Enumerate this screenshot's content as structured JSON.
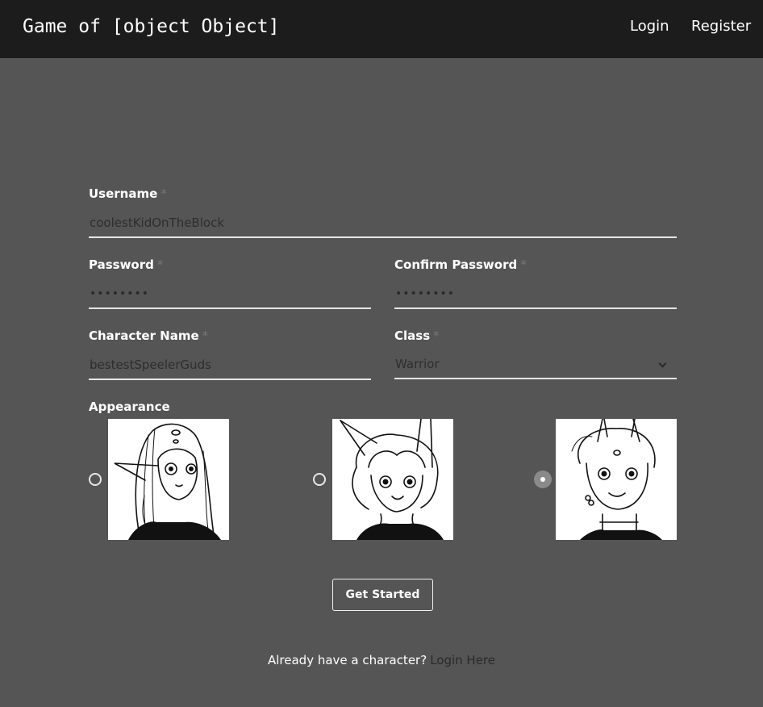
{
  "navbar": {
    "brand": "Game of [object Object]",
    "login": "Login",
    "register": "Register"
  },
  "form": {
    "username": {
      "label": "Username",
      "required_mark": "*",
      "value": "coolestKidOnTheBlock"
    },
    "password": {
      "label": "Password",
      "required_mark": "*",
      "value": "••••••••"
    },
    "confirm_password": {
      "label": "Confirm Password",
      "required_mark": "*",
      "value": "••••••••"
    },
    "character_name": {
      "label": "Character Name",
      "required_mark": "*",
      "value": "bestestSpeelerGuds"
    },
    "class": {
      "label": "Class",
      "required_mark": "*",
      "value": "Warrior"
    },
    "appearance": {
      "label": "Appearance",
      "options": [
        {
          "name": "elf-portrait",
          "selected": false
        },
        {
          "name": "catgirl-portrait",
          "selected": false
        },
        {
          "name": "horned-portrait",
          "selected": true
        }
      ]
    },
    "submit": "Get Started"
  },
  "footer": {
    "question": "Already have a character?",
    "link": "Login Here"
  },
  "colors": {
    "navbar_bg": "#1c1c1c",
    "page_bg": "#555555",
    "input_text": "#2e2e2e",
    "underline": "#e6e6e6"
  }
}
